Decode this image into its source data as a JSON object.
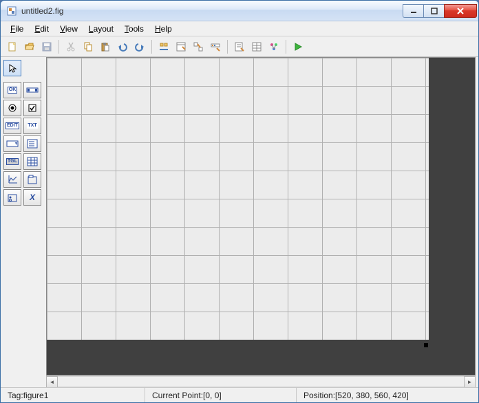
{
  "window": {
    "title": "untitled2.fig"
  },
  "menus": {
    "file": "File",
    "edit": "Edit",
    "view": "View",
    "layout": "Layout",
    "tools": "Tools",
    "help": "Help"
  },
  "status": {
    "tag_label": "Tag: ",
    "tag_value": "figure1",
    "current_point_label": "Current Point: ",
    "current_point_value": "[0, 0]",
    "position_label": "Position: ",
    "position_value": "[520, 380, 560, 420]"
  },
  "palette": {
    "select": "",
    "pushbutton": "OK",
    "slider": "",
    "radiobutton": "",
    "checkbox": "",
    "edittext": "EDIT",
    "statictext": "TXT",
    "popupmenu": "",
    "listbox": "",
    "togglebutton": "TGL",
    "table": "",
    "axes": "",
    "panel": "",
    "buttongroup": "",
    "activex": "X"
  }
}
